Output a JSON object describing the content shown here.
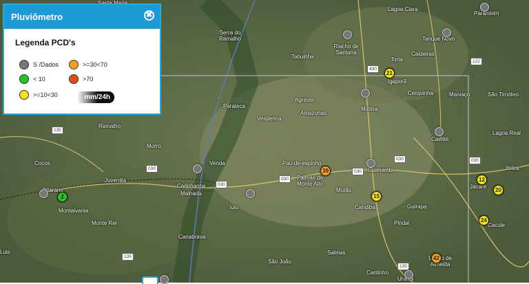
{
  "panel": {
    "title": "Pluviômetro",
    "close_icon": "✖",
    "legend_title": "Legenda PCD's",
    "legend": [
      {
        "label": "S /Dados",
        "color": "#777777"
      },
      {
        "label": ">=30<70",
        "color": "#f5a020"
      },
      {
        "label": "< 10",
        "color": "#22c522"
      },
      {
        "label": ">70",
        "color": "#e74a1e"
      },
      {
        "label": ">=10<30",
        "color": "#f2e21a"
      }
    ],
    "unit": "mm/24h"
  },
  "map": {
    "places": [
      "Santa Maria",
      "Serra do Ramalho",
      "Riacho de Santana",
      "Tabuinha",
      "Lagoa Clara",
      "Paramirim",
      "Tanque Novo",
      "Torta",
      "Caldeiras",
      "Igaporã",
      "Cerquinha",
      "Maniaçu",
      "São Timóteo",
      "Parateca",
      "Agreste",
      "Amazonas",
      "Matina",
      "Caetité",
      "Lagoa Real",
      "Vesperina",
      "Ramalho",
      "Morro",
      "Cocos",
      "Pau-de-espinho",
      "Guanambi",
      "Venda",
      "Juvenilia",
      "Carinhanha",
      "Malhada",
      "Palmas de Monte Alto",
      "Mutãs",
      "Jacaré",
      "Ibitira",
      "Candiba",
      "Guirapa",
      "Cacule",
      "Pindaí",
      "Urandi",
      "Licinio de Almeida",
      "Montalvania",
      "Monte Rei",
      "Canabrava",
      "São João",
      "Salinas",
      "Cantinho",
      "Iuiu",
      "Pitarana",
      "Luis"
    ],
    "roads": [
      "135",
      "430",
      "122",
      "030",
      "030",
      "030",
      "030",
      "030",
      "030",
      "135",
      "135"
    ],
    "stations": [
      {
        "value": "21",
        "color": "#f2e21a"
      },
      {
        "value": "39",
        "color": "#f5a020"
      },
      {
        "value": "15",
        "color": "#f2e21a"
      },
      {
        "value": "12",
        "color": "#f2e21a"
      },
      {
        "value": "20",
        "color": "#f2e21a"
      },
      {
        "value": "24",
        "color": "#f2e21a"
      },
      {
        "value": "42",
        "color": "#f5a020"
      },
      {
        "value": "2",
        "color": "#22c522"
      }
    ]
  }
}
